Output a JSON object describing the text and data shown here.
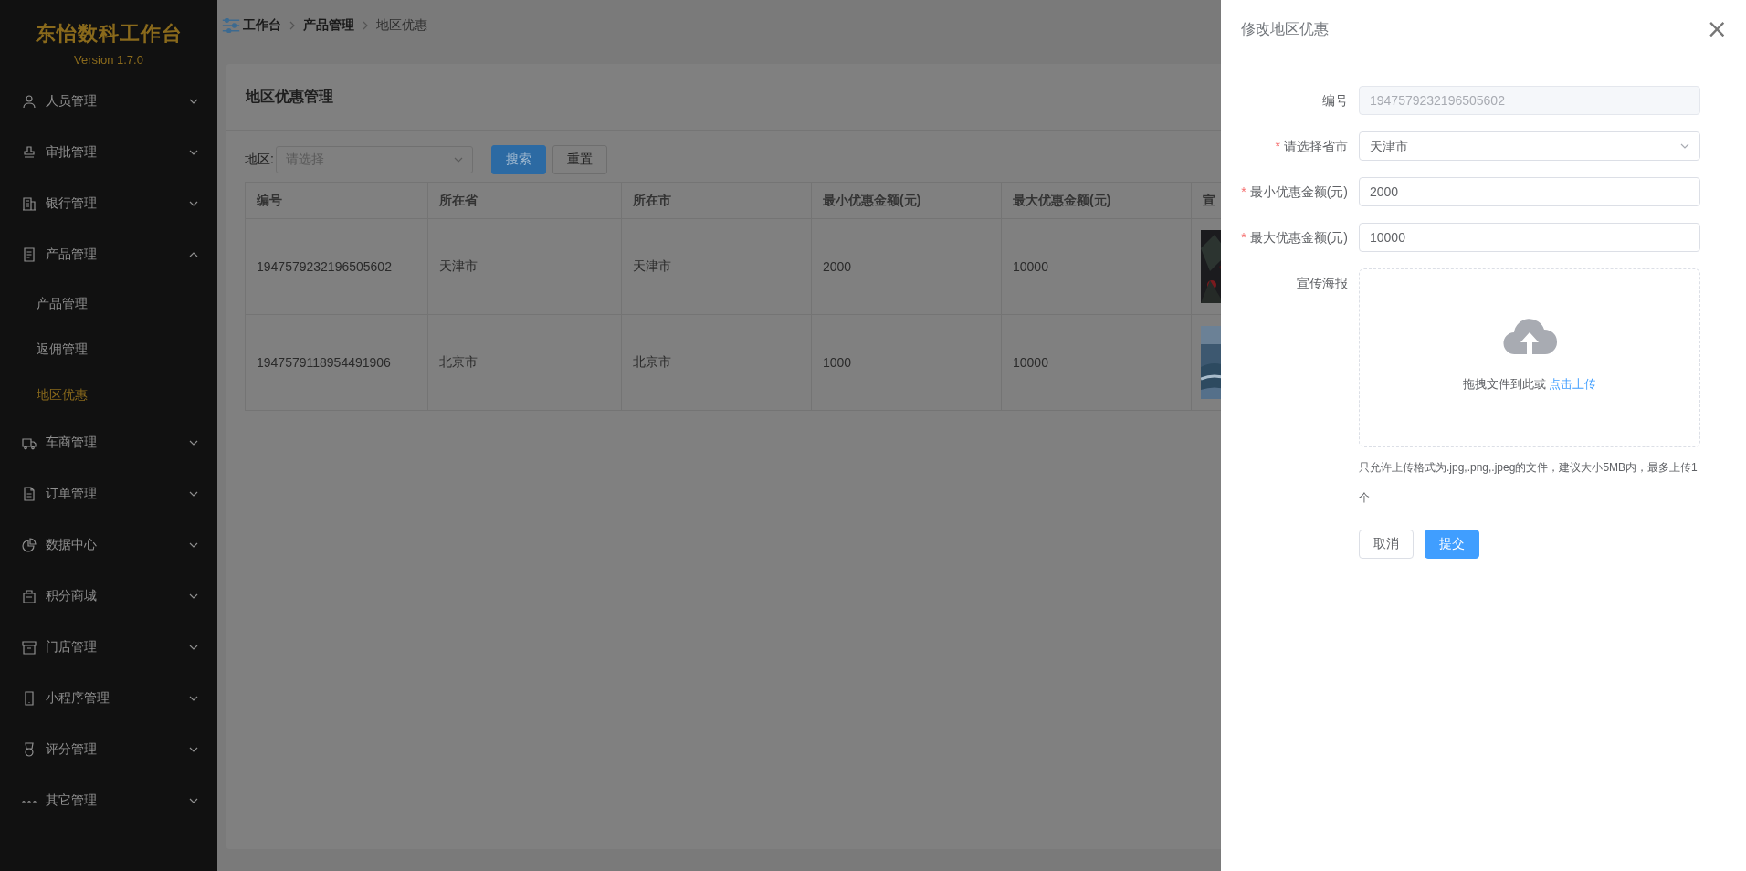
{
  "sidebar": {
    "title": "东怡数科工作台",
    "version": "Version 1.7.0",
    "items": [
      {
        "label": "人员管理",
        "expanded": false
      },
      {
        "label": "审批管理",
        "expanded": false
      },
      {
        "label": "银行管理",
        "expanded": false
      },
      {
        "label": "产品管理",
        "expanded": true,
        "children": [
          {
            "label": "产品管理",
            "selected": false
          },
          {
            "label": "返佣管理",
            "selected": false
          },
          {
            "label": "地区优惠",
            "selected": true
          }
        ]
      },
      {
        "label": "车商管理",
        "expanded": false
      },
      {
        "label": "订单管理",
        "expanded": false
      },
      {
        "label": "数据中心",
        "expanded": false
      },
      {
        "label": "积分商城",
        "expanded": false
      },
      {
        "label": "门店管理",
        "expanded": false
      },
      {
        "label": "小程序管理",
        "expanded": false
      },
      {
        "label": "评分管理",
        "expanded": false
      },
      {
        "label": "其它管理",
        "expanded": false
      }
    ]
  },
  "breadcrumb": [
    "工作台",
    "产品管理",
    "地区优惠"
  ],
  "card": {
    "title": "地区优惠管理",
    "filter": {
      "label": "地区:",
      "placeholder": "请选择",
      "buttons": [
        {
          "label": "搜索",
          "kind": "primary"
        },
        {
          "label": "重置",
          "kind": "default"
        }
      ]
    },
    "table": {
      "columns": [
        "编号",
        "所在省",
        "所在市",
        "最小优惠金额(元)",
        "最大优惠金额(元)",
        "宣"
      ],
      "rows": [
        {
          "cells": [
            "1947579232196505602",
            "天津市",
            "天津市",
            "2000",
            "10000"
          ],
          "poster": {
            "kind": "picture"
          }
        },
        {
          "cells": [
            "1947579118954491906",
            "北京市",
            "北京市",
            "1000",
            "10000"
          ],
          "poster": {
            "kind": "picture"
          }
        }
      ]
    }
  },
  "drawer": {
    "title": "修改地区优惠",
    "close": "×",
    "fields": [
      {
        "label": "编号",
        "kind": "input",
        "disabled": true,
        "value": "1947579232196505602"
      },
      {
        "label": "请选择省市",
        "kind": "select",
        "mark": "*",
        "value": "天津市"
      },
      {
        "label": "最小优惠金额(元)",
        "kind": "input",
        "mark": "*",
        "disabled": false,
        "value": "2000"
      },
      {
        "label": "最大优惠金额(元)",
        "kind": "input",
        "mark": "*",
        "disabled": false,
        "value": "10000"
      },
      {
        "label": "宣传海报",
        "kind": "upload",
        "text": "拖拽文件到此或",
        "link": "点击上传"
      }
    ],
    "tip": "只允许上传格式为.jpg,.png,.jpeg的文件，建议大小5MB内，最多上传1个",
    "buttons": [
      {
        "label": "取消",
        "kind": "default"
      },
      {
        "label": "提交",
        "kind": "primary"
      }
    ]
  }
}
